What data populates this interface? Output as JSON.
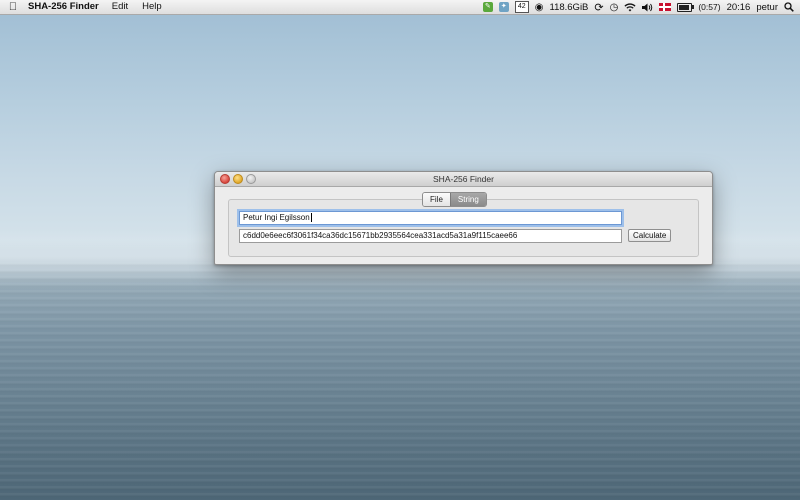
{
  "menubar": {
    "app_name": "SHA-256 Finder",
    "menus": [
      "Edit",
      "Help"
    ],
    "tray": {
      "calendar_day": "42",
      "disk_free": "118.6GiB",
      "battery_time": "(0:57)",
      "battery_level": 0.85,
      "clock": "20:16",
      "user": "petur"
    }
  },
  "window": {
    "title": "SHA-256 Finder",
    "tabs": [
      {
        "label": "File",
        "selected": false
      },
      {
        "label": "String",
        "selected": true
      }
    ],
    "input_value": "Petur Ingi Egilsson",
    "hash_value": "c6dd0e6eec6f3061f34ca36dc15671bb2935564cea331acd5a31a9f115caee66",
    "calculate_label": "Calculate"
  },
  "colors": {
    "accent_focus": "#6d98d3",
    "close": "#d8463c",
    "minimize": "#e0a829",
    "zoom": "#c9c9c9"
  }
}
